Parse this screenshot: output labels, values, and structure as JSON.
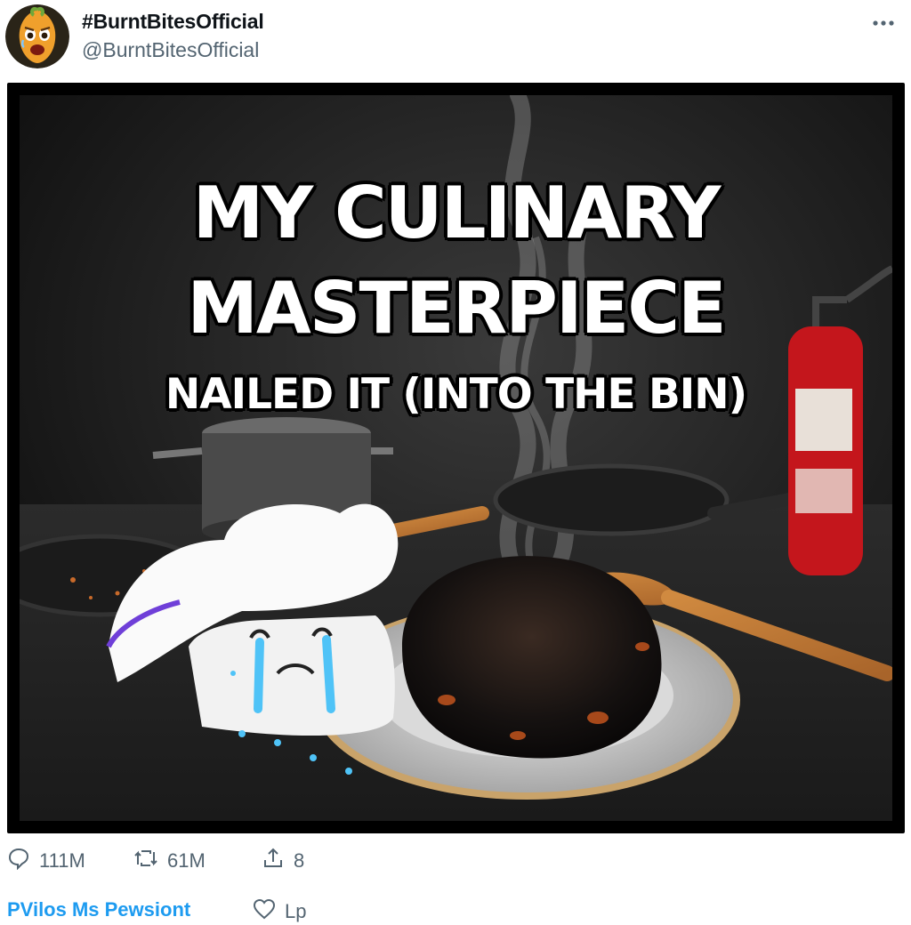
{
  "post": {
    "display_name": "#BurntBitesOfficial",
    "handle": "@BurntBitesOfficial",
    "more_icon": "more-horizontal-icon"
  },
  "meme": {
    "line1": "MY CULINARY",
    "line2": "MASTERPIECE",
    "line3": "NAILED IT (INTO THE BIN)"
  },
  "actions": {
    "replies": "111M",
    "reposts": "61M",
    "shares": "8"
  },
  "partial_row": {
    "link_text": "PVilos Ms Pewsiont",
    "like_text": "Lp"
  },
  "colors": {
    "accent": "#1d9bf0",
    "secondary_text": "#536471"
  }
}
